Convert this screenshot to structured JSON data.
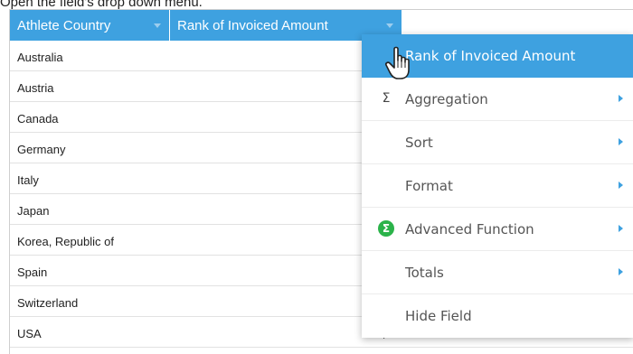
{
  "caption": "Open the field's drop down menu.",
  "table": {
    "columns": [
      "Athlete Country",
      "Rank of Invoiced Amount"
    ],
    "rows": [
      {
        "country": "Australia",
        "amount": ""
      },
      {
        "country": "Austria",
        "amount": ""
      },
      {
        "country": "Canada",
        "amount": ""
      },
      {
        "country": "Germany",
        "amount": ""
      },
      {
        "country": "Italy",
        "amount": ""
      },
      {
        "country": "Japan",
        "amount": ""
      },
      {
        "country": "Korea, Republic of",
        "amount": ""
      },
      {
        "country": "Spain",
        "amount": ""
      },
      {
        "country": "Switzerland",
        "amount": ""
      },
      {
        "country": "USA",
        "amount": "$2"
      }
    ]
  },
  "menu": {
    "items": [
      {
        "label": "Rank of Invoiced Amount",
        "icon": "",
        "submenu": false,
        "active": true
      },
      {
        "label": "Aggregation",
        "icon": "sigma-icon",
        "submenu": true
      },
      {
        "label": "Sort",
        "icon": "",
        "submenu": true
      },
      {
        "label": "Format",
        "icon": "",
        "submenu": true
      },
      {
        "label": "Advanced Function",
        "icon": "advanced-function-icon",
        "submenu": true
      },
      {
        "label": "Totals",
        "icon": "",
        "submenu": true
      },
      {
        "label": "Hide Field",
        "icon": "",
        "submenu": false
      }
    ]
  },
  "colors": {
    "accent": "#3ea1e0",
    "advanced_function_icon": "#2bb34a"
  }
}
